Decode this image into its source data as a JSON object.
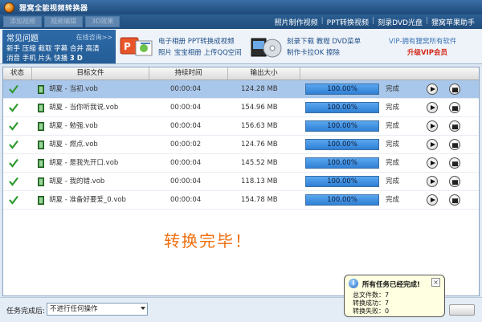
{
  "window": {
    "title": "狸窝全能视频转换器"
  },
  "toolbar": {
    "buttons": [
      "添加视频",
      "视频编辑",
      "3D效果"
    ]
  },
  "menu": {
    "items": [
      "照片制作视频",
      "PPT转换视频",
      "刻录DVD光盘",
      "狸窝苹果助手"
    ]
  },
  "faq": {
    "title": "常见问题",
    "more": "在线咨询>>",
    "line1": [
      "新手",
      "压缩",
      "截取",
      "字幕",
      "合并",
      "高清"
    ],
    "line2": [
      "消音",
      "手机",
      "片头",
      "快播",
      "3 D"
    ]
  },
  "promo": {
    "ppt_line1": "电子相册 PPT转换成视频",
    "ppt_line2": "照片 宝宝相册 上传QQ空间",
    "dvd_line1": "刻录下载 教程 DVD菜单",
    "dvd_line2": "制作卡拉OK 擦除",
    "vip_line1": "VIP-拥有狸窝所有软件",
    "vip_line2": "升级VIP会员"
  },
  "table": {
    "headers": [
      "状态",
      "目标文件",
      "持续时间",
      "输出大小"
    ],
    "rows": [
      {
        "file": "胡夏 - 当初.vob",
        "duration": "00:00:04",
        "size": "124.28 MB",
        "progress": "100.00%",
        "status": "完成",
        "progress_fraction": 1.0
      },
      {
        "file": "胡夏 - 当你听我说.vob",
        "duration": "00:00:04",
        "size": "154.96 MB",
        "progress": "100.00%",
        "status": "完成",
        "progress_fraction": 1.0
      },
      {
        "file": "胡夏 - 勉强.vob",
        "duration": "00:00:04",
        "size": "156.63 MB",
        "progress": "100.00%",
        "status": "完成",
        "progress_fraction": 1.0
      },
      {
        "file": "胡夏 - 燃点.vob",
        "duration": "00:00:02",
        "size": "124.76 MB",
        "progress": "100.00%",
        "status": "完成",
        "progress_fraction": 1.0
      },
      {
        "file": "胡夏 - 是我先开口.vob",
        "duration": "00:00:04",
        "size": "145.52 MB",
        "progress": "100.00%",
        "status": "完成",
        "progress_fraction": 1.0
      },
      {
        "file": "胡夏 - 我的错.vob",
        "duration": "00:00:04",
        "size": "118.13 MB",
        "progress": "100.00%",
        "status": "完成",
        "progress_fraction": 1.0
      },
      {
        "file": "胡夏 - 准备好要爱_0.vob",
        "duration": "00:00:04",
        "size": "154.78 MB",
        "progress": "100.00%",
        "status": "完成",
        "progress_fraction": 1.0
      }
    ]
  },
  "done_message": "转换完毕！",
  "bottom": {
    "label": "任务完成后:",
    "select_value": "不进行任何操作"
  },
  "balloon": {
    "title": "所有任务已经完成!",
    "total": "总文件数：7",
    "success": "转换成功：7",
    "failed": "转换失败：0"
  },
  "colors": {
    "accent": "#2f7fd4",
    "title_bar": "#1e4a7a",
    "done_text": "#f07010",
    "vip": "#d4291b",
    "check": "#2f9a2f"
  }
}
